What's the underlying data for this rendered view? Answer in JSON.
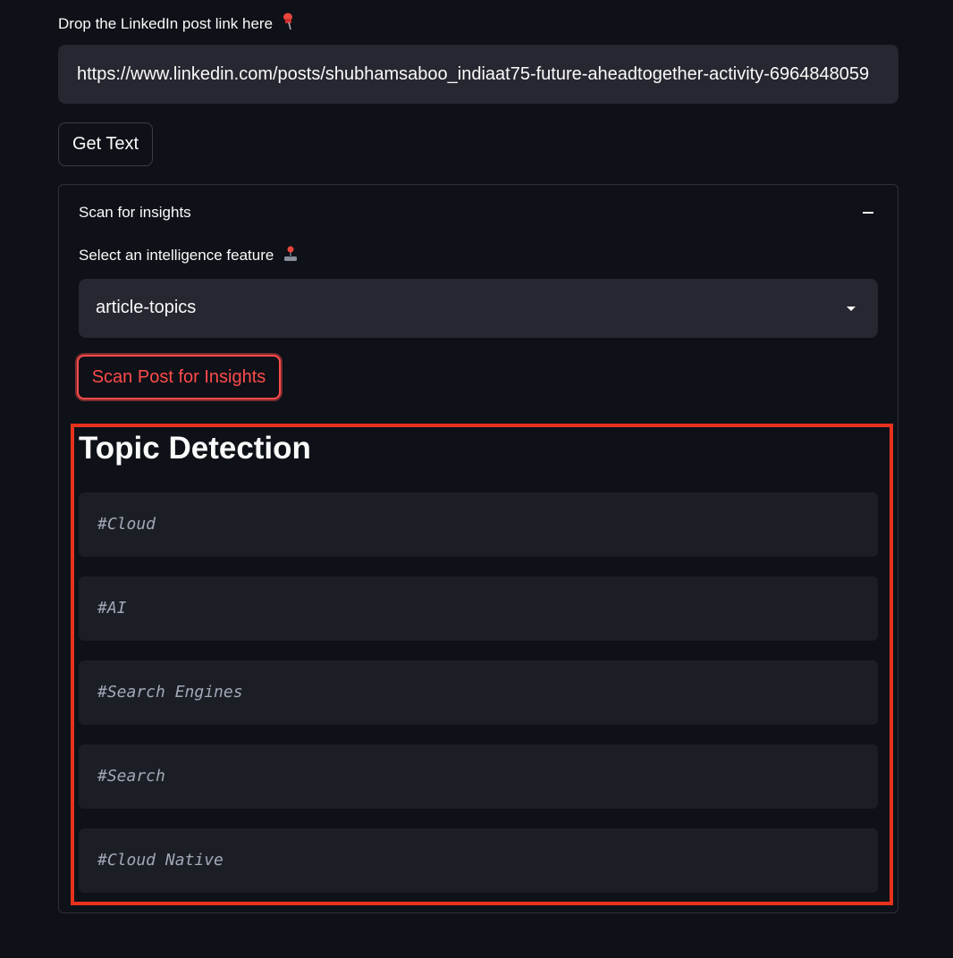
{
  "url_field": {
    "label": "Drop the LinkedIn post link here",
    "label_icon": "pushpin-icon",
    "value": "https://www.linkedin.com/posts/shubhamsaboo_indiaat75-future-aheadtogether-activity-6964848059"
  },
  "get_text_button": {
    "label": "Get Text"
  },
  "expander": {
    "title": "Scan for insights",
    "collapse_icon": "minus-icon",
    "feature_select": {
      "label": "Select an intelligence feature",
      "label_icon": "joystick-icon",
      "value": "article-topics"
    },
    "scan_button": {
      "label": "Scan Post for Insights"
    },
    "results": {
      "heading": "Topic Detection",
      "topics": [
        "#Cloud",
        "#AI",
        "#Search Engines",
        "#Search",
        "#Cloud Native"
      ]
    }
  },
  "colors": {
    "background": "#0e1117",
    "input_bg": "#262730",
    "topic_bg": "#1c1e26",
    "accent": "#ff4b4b",
    "highlight_border": "#e8321e"
  }
}
